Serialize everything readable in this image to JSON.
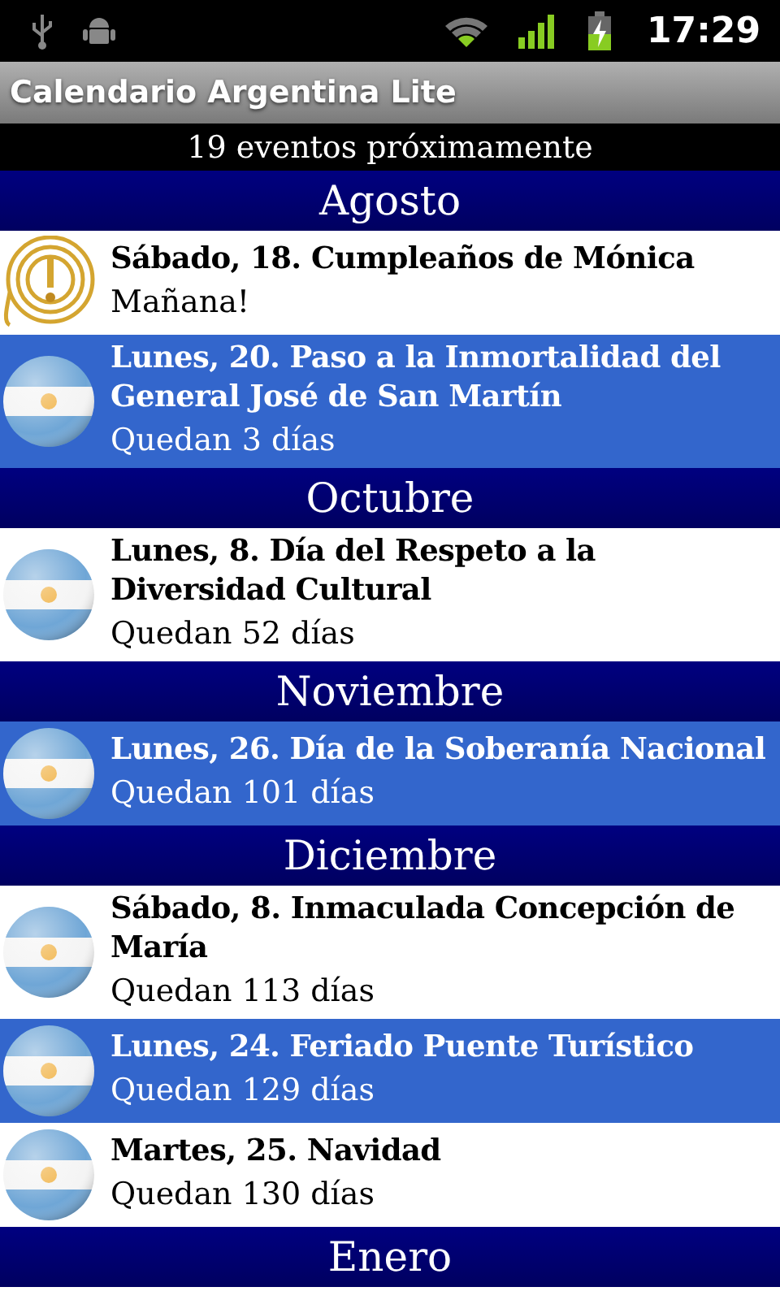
{
  "status_bar": {
    "time": "17:29"
  },
  "window": {
    "title": "Calendario Argentina Lite"
  },
  "summary": "19 eventos próximamente",
  "sections": [
    {
      "month": "Agosto",
      "events": [
        {
          "kind": "reminder",
          "title": "Sábado, 18. Cumpleaños de Mónica",
          "countdown": "Mañana!",
          "highlighted": false
        },
        {
          "kind": "flag",
          "title": "Lunes, 20. Paso a la Inmortalidad del General José de San Martín",
          "countdown": "Quedan 3 días",
          "highlighted": true
        }
      ]
    },
    {
      "month": "Octubre",
      "events": [
        {
          "kind": "flag",
          "title": "Lunes, 8. Día del Respeto a la Diversidad Cultural",
          "countdown": "Quedan 52 días",
          "highlighted": false
        }
      ]
    },
    {
      "month": "Noviembre",
      "events": [
        {
          "kind": "flag",
          "title": "Lunes, 26. Día de la Soberanía Nacional",
          "countdown": "Quedan 101 días",
          "highlighted": true
        }
      ]
    },
    {
      "month": "Diciembre",
      "events": [
        {
          "kind": "flag",
          "title": "Sábado, 8. Inmaculada Concepción de María",
          "countdown": "Quedan 113 días",
          "highlighted": false
        },
        {
          "kind": "flag",
          "title": "Lunes, 24. Feriado Puente Turístico",
          "countdown": "Quedan 129 días",
          "highlighted": true
        },
        {
          "kind": "flag",
          "title": "Martes, 25. Navidad",
          "countdown": "Quedan 130 días",
          "highlighted": false
        }
      ]
    },
    {
      "month": "Enero"
    }
  ]
}
